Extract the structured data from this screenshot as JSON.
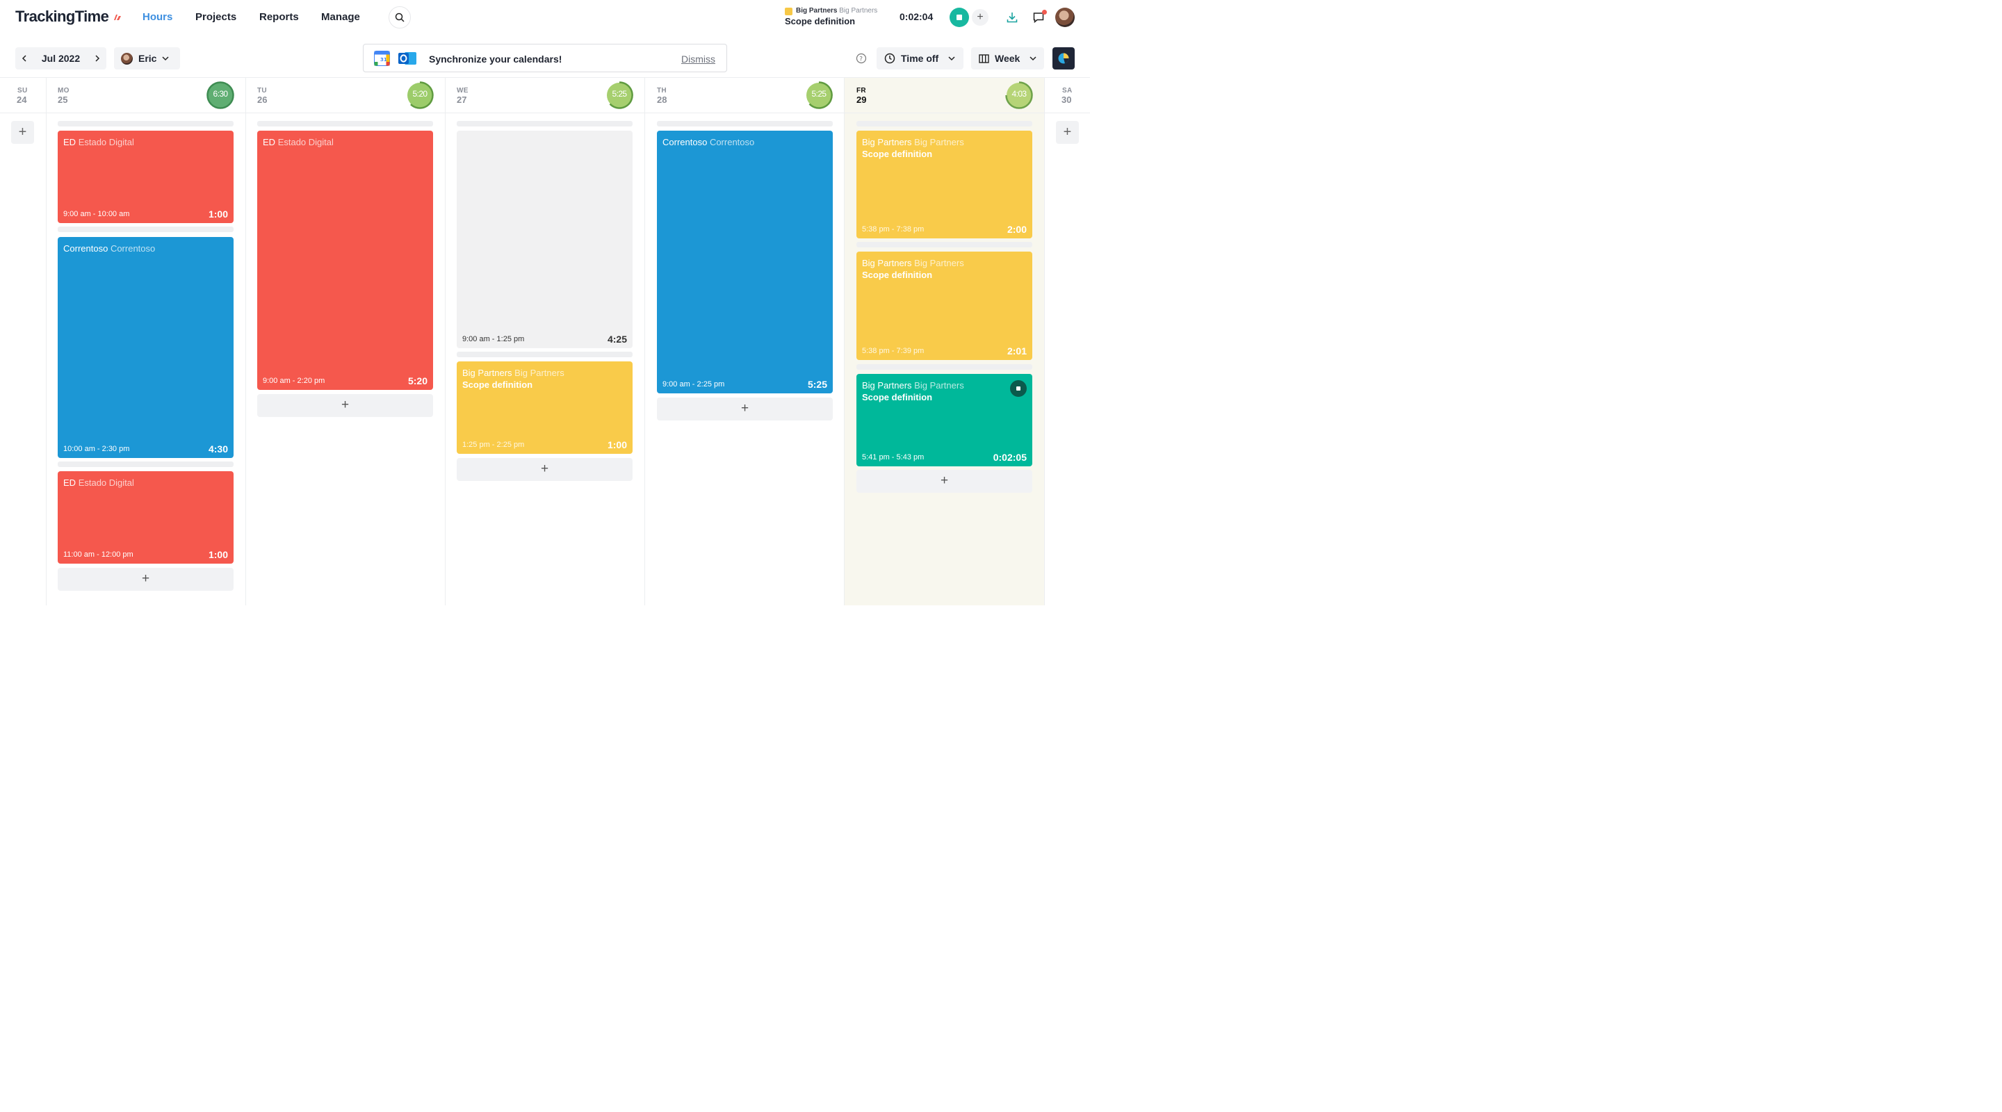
{
  "app": {
    "logo": "TrackingTime",
    "brand_color": "#3d8fe0",
    "nav": [
      "Hours",
      "Projects",
      "Reports",
      "Manage"
    ],
    "active_nav": "Hours"
  },
  "current_timer": {
    "client": "Big Partners",
    "project": "Big Partners",
    "task": "Scope definition",
    "elapsed": "0:02:04"
  },
  "toolbar": {
    "month": "Jul 2022",
    "user": "Eric",
    "sync_message": "Synchronize your calendars!",
    "dismiss": "Dismiss",
    "time_off": "Time off",
    "view": "Week"
  },
  "days": [
    {
      "abbr": "SU",
      "num": "24"
    },
    {
      "abbr": "MO",
      "num": "25",
      "total": "6:30"
    },
    {
      "abbr": "TU",
      "num": "26",
      "total": "5:20"
    },
    {
      "abbr": "WE",
      "num": "27",
      "total": "5:25"
    },
    {
      "abbr": "TH",
      "num": "28",
      "total": "5:25"
    },
    {
      "abbr": "FR",
      "num": "29",
      "total": "4:03"
    },
    {
      "abbr": "SA",
      "num": "30"
    }
  ],
  "entries": {
    "mon": [
      {
        "client": "ED",
        "project": "Estado Digital",
        "time": "9:00 am - 10:00 am",
        "duration": "1:00"
      },
      {
        "client": "Correntoso",
        "project": "Correntoso",
        "time": "10:00 am - 2:30 pm",
        "duration": "4:30"
      },
      {
        "client": "ED",
        "project": "Estado Digital",
        "time": "11:00 am - 12:00 pm",
        "duration": "1:00"
      }
    ],
    "tue": [
      {
        "client": "ED",
        "project": "Estado Digital",
        "time": "9:00 am - 2:20 pm",
        "duration": "5:20"
      }
    ],
    "wed": [
      {
        "time": "9:00 am - 1:25 pm",
        "duration": "4:25"
      },
      {
        "client": "Big Partners",
        "project": "Big Partners",
        "task": "Scope definition",
        "time": "1:25 pm - 2:25 pm",
        "duration": "1:00"
      }
    ],
    "thu": [
      {
        "client": "Correntoso",
        "project": "Correntoso",
        "time": "9:00 am - 2:25 pm",
        "duration": "5:25"
      }
    ],
    "fri": [
      {
        "client": "Big Partners",
        "project": "Big Partners",
        "task": "Scope definition",
        "time": "5:38 pm - 7:38 pm",
        "duration": "2:00"
      },
      {
        "client": "Big Partners",
        "project": "Big Partners",
        "task": "Scope definition",
        "time": "5:38 pm - 7:39 pm",
        "duration": "2:01"
      },
      {
        "client": "Big Partners",
        "project": "Big Partners",
        "task": "Scope definition",
        "time": "5:41 pm - 5:43 pm",
        "duration": "0:02:05"
      }
    ]
  },
  "colors": {
    "estado_digital": "#f5584d",
    "correntoso": "#1c97d5",
    "big_partners": "#f9cb4a",
    "running": "#00b89a",
    "today_bg": "#f8f7ee"
  },
  "add_symbol": "+"
}
